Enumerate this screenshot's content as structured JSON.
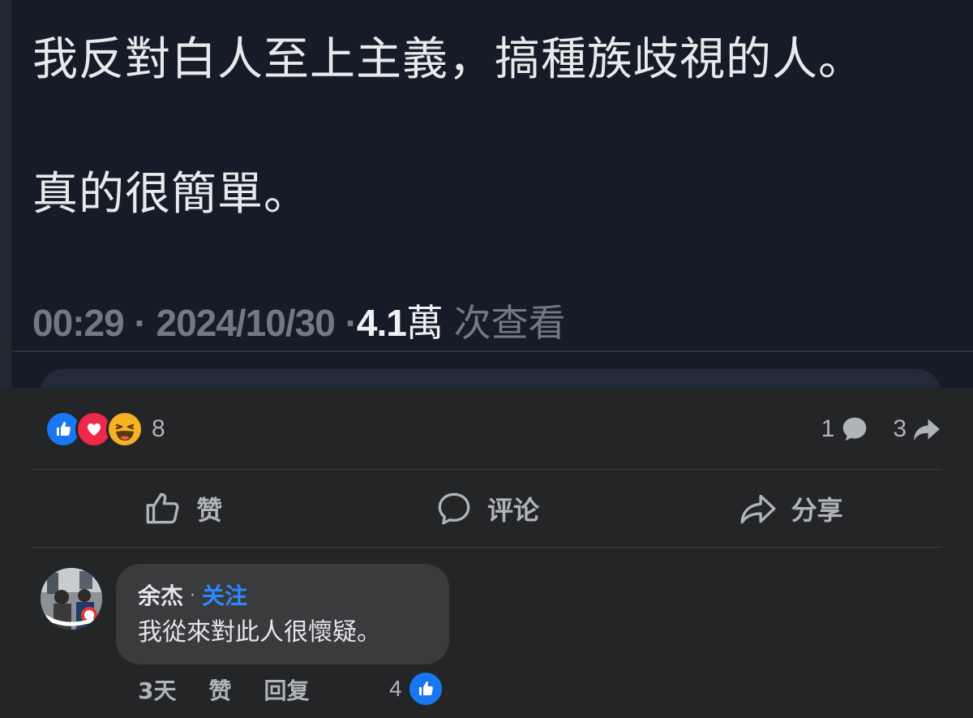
{
  "tweet": {
    "line1": "我反對白人至上主義，搞種族歧視的人。",
    "line2": "真的很簡單。",
    "time": "00:29",
    "sep": "·",
    "date": "2024/10/30",
    "views_number": "4.1",
    "views_unit": "萬",
    "views_label": " 次查看"
  },
  "post": {
    "reactions": [
      "like-icon",
      "love-icon",
      "haha-icon"
    ],
    "reaction_count": "8",
    "comment_count": "1",
    "share_count": "3"
  },
  "actions": {
    "like": "赞",
    "comment": "评论",
    "share": "分享"
  },
  "comment": {
    "author": "余杰",
    "dot": "·",
    "follow": "关注",
    "text": "我從來對此人很懷疑。",
    "time": "3天",
    "like": "赞",
    "reply": "回复",
    "like_count": "4"
  },
  "colors": {
    "facebook_blue": "#1a77f2",
    "love_red": "#f02849",
    "haha_yellow": "#f7b125",
    "follow_blue": "#2d88ff"
  }
}
